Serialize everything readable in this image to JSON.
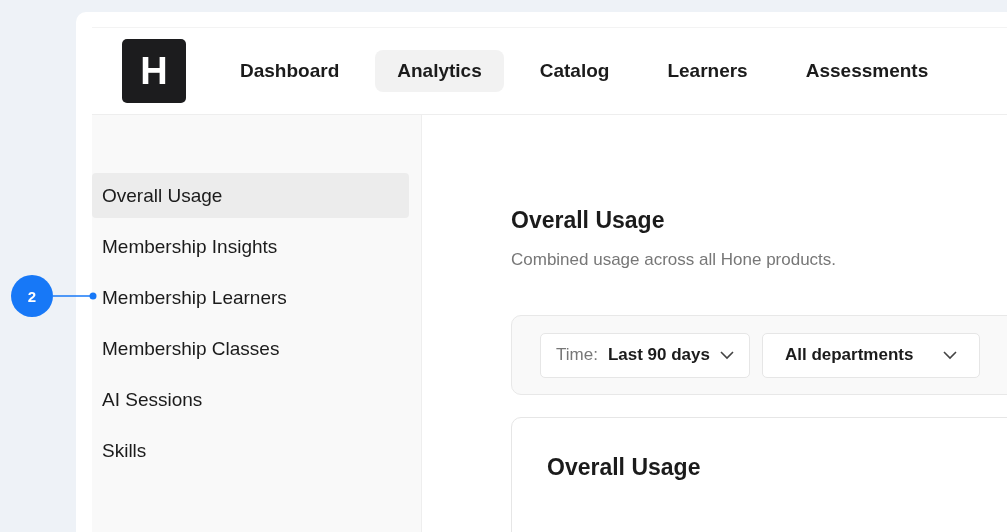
{
  "logo": {
    "letter": "H"
  },
  "nav": [
    {
      "label": "Dashboard",
      "selected": false
    },
    {
      "label": "Analytics",
      "selected": true
    },
    {
      "label": "Catalog",
      "selected": false
    },
    {
      "label": "Learners",
      "selected": false
    },
    {
      "label": "Assessments",
      "selected": false
    }
  ],
  "sidebar": {
    "items": [
      {
        "label": "Overall Usage",
        "selected": true
      },
      {
        "label": "Membership Insights",
        "selected": false
      },
      {
        "label": "Membership Learners",
        "selected": false
      },
      {
        "label": "Membership Classes",
        "selected": false
      },
      {
        "label": "AI Sessions",
        "selected": false
      },
      {
        "label": "Skills",
        "selected": false
      }
    ]
  },
  "annotation": {
    "label": "2"
  },
  "main": {
    "title": "Overall Usage",
    "subtitle": "Combined usage across all Hone products.",
    "filters": [
      {
        "prefix": "Time:",
        "value": "Last 90 days"
      },
      {
        "value": "All departments"
      }
    ],
    "card": {
      "title": "Overall Usage"
    }
  }
}
